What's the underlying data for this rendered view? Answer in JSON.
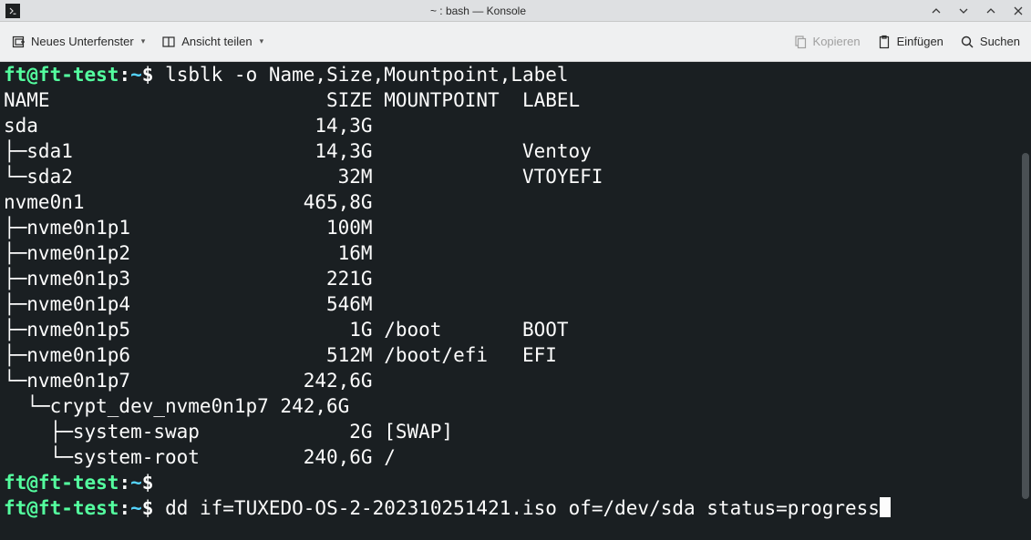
{
  "window": {
    "title": "~ : bash — Konsole"
  },
  "toolbar": {
    "new_tab": "Neues Unterfenster",
    "split_view": "Ansicht teilen",
    "copy": "Kopieren",
    "paste": "Einfügen",
    "search": "Suchen"
  },
  "prompt": {
    "userhost": "ft@ft-test",
    "path": "~",
    "sep": ":",
    "sym": "$"
  },
  "terminal": {
    "cmd1": "lsblk -o Name,Size,Mountpoint,Label",
    "header": "NAME                        SIZE MOUNTPOINT  LABEL",
    "rows": [
      "sda                        14,3G",
      "├─sda1                     14,3G             Ventoy",
      "└─sda2                       32M             VTOYEFI",
      "nvme0n1                   465,8G",
      "├─nvme0n1p1                 100M",
      "├─nvme0n1p2                  16M",
      "├─nvme0n1p3                 221G",
      "├─nvme0n1p4                 546M",
      "├─nvme0n1p5                   1G /boot       BOOT",
      "├─nvme0n1p6                 512M /boot/efi   EFI",
      "└─nvme0n1p7               242,6G",
      "  └─crypt_dev_nvme0n1p7 242,6G",
      "    ├─system-swap             2G [SWAP]",
      "    └─system-root         240,6G /"
    ],
    "cmd2": "",
    "cmd3": "dd if=TUXEDO-OS-2-202310251421.iso of=/dev/sda status=progress"
  }
}
